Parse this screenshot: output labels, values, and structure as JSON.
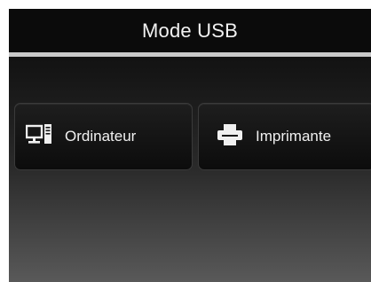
{
  "header": {
    "title": "Mode USB"
  },
  "options": [
    {
      "label": "Ordinateur",
      "icon": "computer-icon"
    },
    {
      "label": "Imprimante",
      "icon": "printer-icon"
    }
  ],
  "colors": {
    "header_bg": "#0b0b0b",
    "divider": "#c9c9c9",
    "text": "#f0f0f0"
  }
}
